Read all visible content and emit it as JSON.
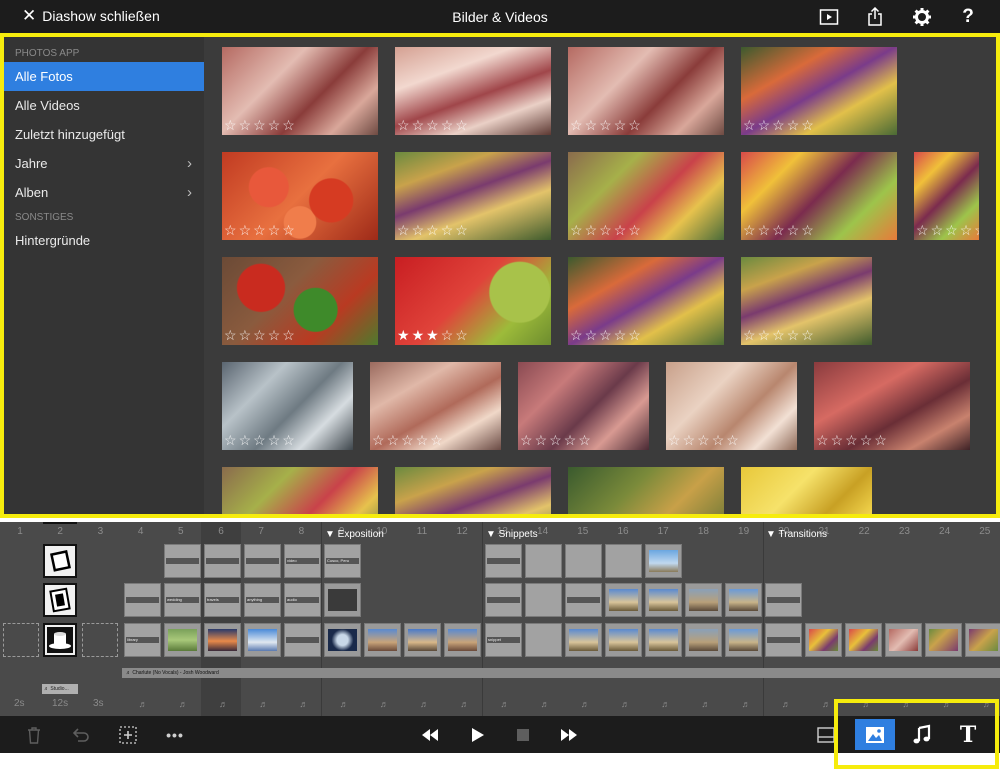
{
  "topbar": {
    "close_label": "Diashow schließen",
    "title": "Bilder & Videos",
    "icons": [
      "play-preview-icon",
      "share-icon",
      "gear-icon",
      "help-icon"
    ],
    "help_label": "?"
  },
  "sidebar": {
    "section_photos": "PHOTOS APP",
    "items": [
      {
        "label": "Alle Fotos",
        "active": true
      },
      {
        "label": "Alle Videos"
      },
      {
        "label": "Zuletzt hinzugefügt"
      },
      {
        "label": "Jahre",
        "chevron": true
      },
      {
        "label": "Alben",
        "chevron": true
      }
    ],
    "section_other": "SONSTIGES",
    "other_items": [
      {
        "label": "Hintergründe"
      }
    ]
  },
  "photos": [
    {
      "subject": "meat-market",
      "rating": 0
    },
    {
      "subject": "meat-market",
      "rating": 0
    },
    {
      "subject": "meat-market",
      "rating": 0
    },
    {
      "subject": "vegetable-vendor",
      "rating": 0
    },
    {
      "subject": "tomatoes",
      "rating": 0
    },
    {
      "subject": "market-stalls",
      "rating": 0
    },
    {
      "subject": "market-stalls",
      "rating": 0
    },
    {
      "subject": "fruit-display",
      "rating": 0
    },
    {
      "subject": "fruit-display",
      "rating": 0
    },
    {
      "subject": "peppers",
      "rating": 0
    },
    {
      "subject": "strawberries",
      "rating": 3
    },
    {
      "subject": "fruit-vendor",
      "rating": 0
    },
    {
      "subject": "vendor",
      "rating": 0
    },
    {
      "subject": "fish",
      "rating": 0
    },
    {
      "subject": "fish",
      "rating": 0
    },
    {
      "subject": "crabs",
      "rating": 0
    },
    {
      "subject": "shrimp",
      "rating": 0
    },
    {
      "subject": "red-fish",
      "rating": 0
    },
    {
      "subject": "market-stalls",
      "rating": 0
    },
    {
      "subject": "market-stalls",
      "rating": 0
    },
    {
      "subject": "pineapples",
      "rating": 0
    },
    {
      "subject": "bananas",
      "rating": 0
    }
  ],
  "timeline": {
    "ruler_numbers": [
      "1",
      "2",
      "3",
      "4",
      "5",
      "6",
      "7",
      "8",
      "9",
      "10",
      "11",
      "12",
      "13",
      "14",
      "15",
      "16",
      "17",
      "18",
      "19",
      "20",
      "21",
      "22",
      "23",
      "24",
      "25"
    ],
    "sections": [
      "▼ Exposition",
      "▼ Snippets",
      "▼ Transitions"
    ],
    "clip_labels": {
      "wedding": "wedding",
      "travels": "travels",
      "anything": "anything",
      "audio": "audio",
      "video": "video",
      "cusco": "Cusco, Peru",
      "library": "library",
      "snippet": "snippet"
    },
    "audio_track": "♬ Charlute (No Vocals) - Josh Woodward",
    "studio_chip": "♬ Studio...",
    "durations": [
      "2s",
      "12s",
      "3s"
    ],
    "note_glyph": "♬"
  },
  "bottombar": {
    "left_icons": [
      "trash-icon",
      "undo-icon",
      "add-slide-icon",
      "more-icon"
    ],
    "more_label": "•••",
    "transport": [
      "rewind-icon",
      "play-icon",
      "stop-icon",
      "fast-forward-icon"
    ],
    "right_tabs": [
      {
        "name": "layout-icon"
      },
      {
        "name": "photos-tab-icon",
        "active": true
      },
      {
        "name": "music-tab-icon"
      },
      {
        "name": "text-tab-icon",
        "label": "T"
      }
    ]
  },
  "colors": {
    "accent": "#2f7fe0",
    "highlight": "#f6ec0d",
    "bar": "#1c1c1c",
    "panel": "#3a3a3a"
  }
}
